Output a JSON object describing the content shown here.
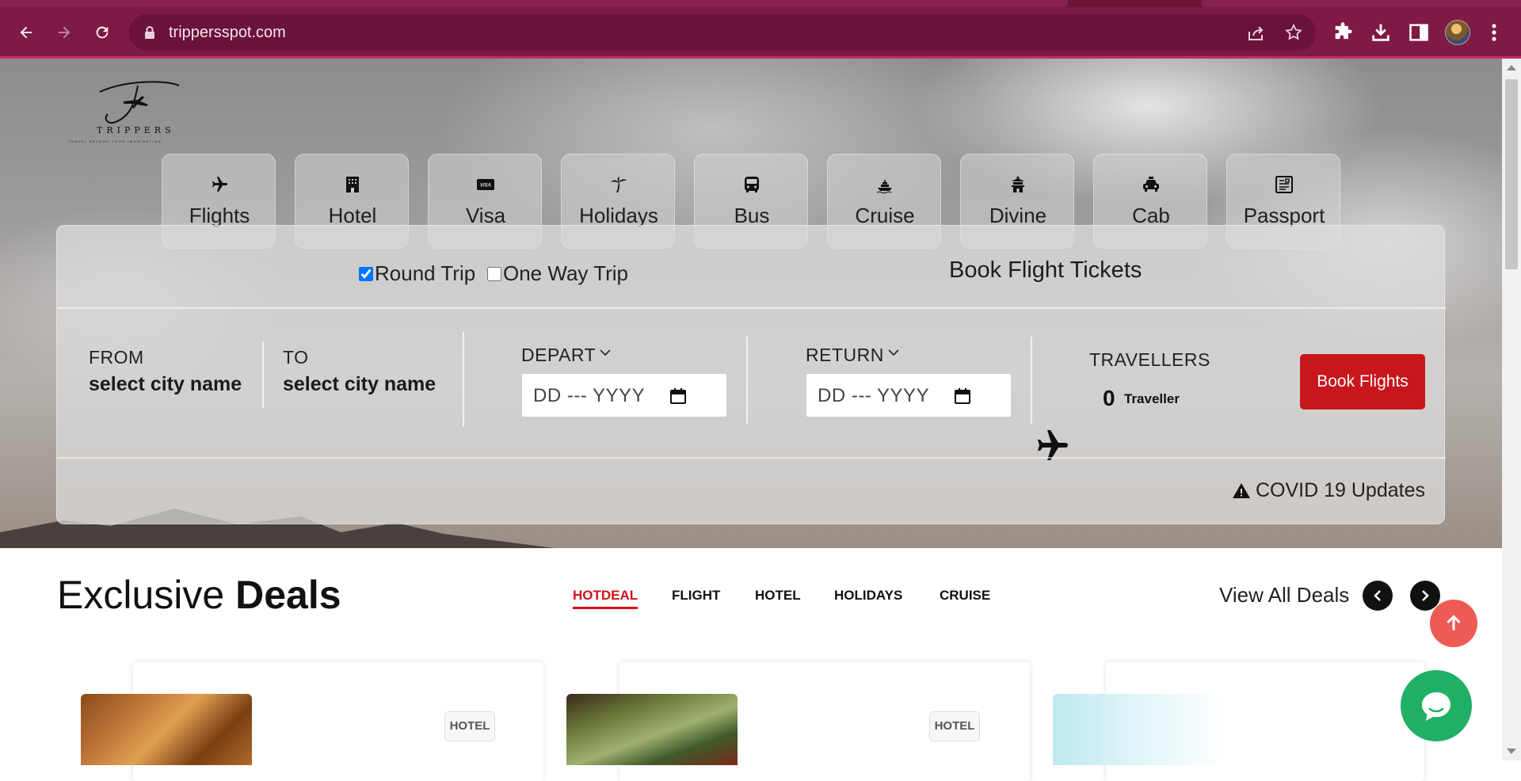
{
  "browser": {
    "url": "trippersspot.com",
    "icons": [
      "back-icon",
      "forward-icon",
      "reload-icon",
      "lock-icon",
      "share-icon",
      "star-icon",
      "extensions-icon",
      "download-icon",
      "sidepanel-icon",
      "menu-icon"
    ],
    "theme_color": "#7e1a44"
  },
  "site": {
    "logo": {
      "brand": "TRIPPERS",
      "tagline": "TRAVEL BEYOND YOUR IMAGINATION"
    },
    "services": [
      {
        "label": "Flights",
        "icon": "plane-icon"
      },
      {
        "label": "Hotel",
        "icon": "hotel-icon"
      },
      {
        "label": "Visa",
        "icon": "visa-card-icon"
      },
      {
        "label": "Holidays",
        "icon": "palm-tree-icon"
      },
      {
        "label": "Bus",
        "icon": "bus-icon"
      },
      {
        "label": "Cruise",
        "icon": "ship-icon"
      },
      {
        "label": "Divine",
        "icon": "temple-icon"
      },
      {
        "label": "Cab",
        "icon": "taxi-icon"
      },
      {
        "label": "Passport",
        "icon": "passport-icon"
      }
    ]
  },
  "search": {
    "round_trip_label": "Round Trip",
    "round_trip_checked": true,
    "one_way_label": "One Way Trip",
    "one_way_checked": false,
    "headline": "Book Flight Tickets",
    "from_caption": "FROM",
    "from_value": "select city name",
    "to_caption": "TO",
    "to_value": "select city name",
    "depart_caption": "DEPART",
    "depart_placeholder": "DD --- YYYY",
    "return_caption": "RETURN",
    "return_placeholder": "DD --- YYYY",
    "travellers_caption": "TRAVELLERS",
    "travellers_count": "0",
    "travellers_unit": "Traveller",
    "book_button": "Book Flights",
    "covid_link": "COVID 19 Updates",
    "accent_color": "#c8161d"
  },
  "deals": {
    "title_light": "Exclusive",
    "title_bold": "Deals",
    "tabs": [
      "HOTDEAL",
      "FLIGHT",
      "HOTEL",
      "HOLIDAYS",
      "CRUISE"
    ],
    "active_tab": "HOTDEAL",
    "view_all": "View All Deals",
    "cards": [
      {
        "badge": "HOTEL"
      },
      {
        "badge": "HOTEL"
      },
      {
        "badge": ""
      }
    ]
  },
  "floating": {
    "back_to_top_icon": "arrow-up-icon",
    "chat_icon": "chat-bubble-icon",
    "back_to_top_color": "#ee5b55",
    "chat_color": "#1fb066"
  }
}
